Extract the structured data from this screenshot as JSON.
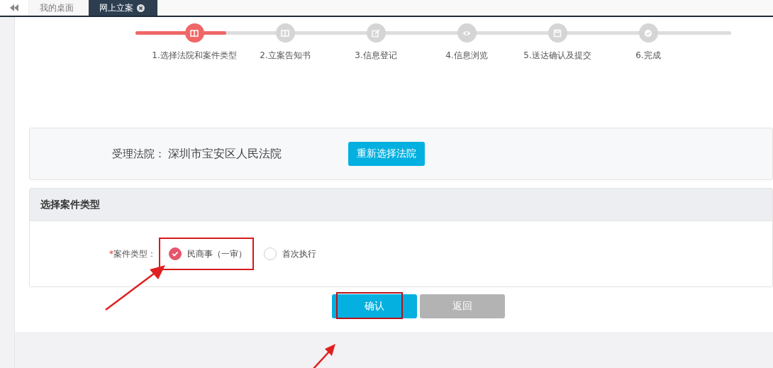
{
  "tabs": [
    {
      "label": "我的桌面",
      "selected": false,
      "closable": false
    },
    {
      "label": "网上立案",
      "selected": true,
      "closable": true
    }
  ],
  "progress": {
    "level": 0.152,
    "steps": [
      {
        "label": "1.选择法院和案件类型",
        "active": true,
        "kind": "columns"
      },
      {
        "label": "2.立案告知书",
        "active": false,
        "kind": "columns"
      },
      {
        "label": "3.信息登记",
        "active": false,
        "kind": "edit"
      },
      {
        "label": "4.信息浏览",
        "active": false,
        "kind": "eye"
      },
      {
        "label": "5.送达确认及提交",
        "active": false,
        "kind": "save"
      },
      {
        "label": "6.完成",
        "active": false,
        "kind": "check"
      }
    ]
  },
  "court": {
    "label": "受理法院：",
    "value": "深圳市宝安区人民法院",
    "button": "重新选择法院"
  },
  "case_type": {
    "title": "选择案件类型",
    "required_mark": "*",
    "label": "案件类型：",
    "options": [
      {
        "label": "民商事（一审）",
        "selected": true,
        "highlighted": true
      },
      {
        "label": "首次执行",
        "selected": false,
        "highlighted": false
      }
    ]
  },
  "buttons": [
    {
      "label": "确认",
      "kind": "primary",
      "highlighted": true
    },
    {
      "label": "返回",
      "kind": "disabled",
      "highlighted": false
    }
  ]
}
